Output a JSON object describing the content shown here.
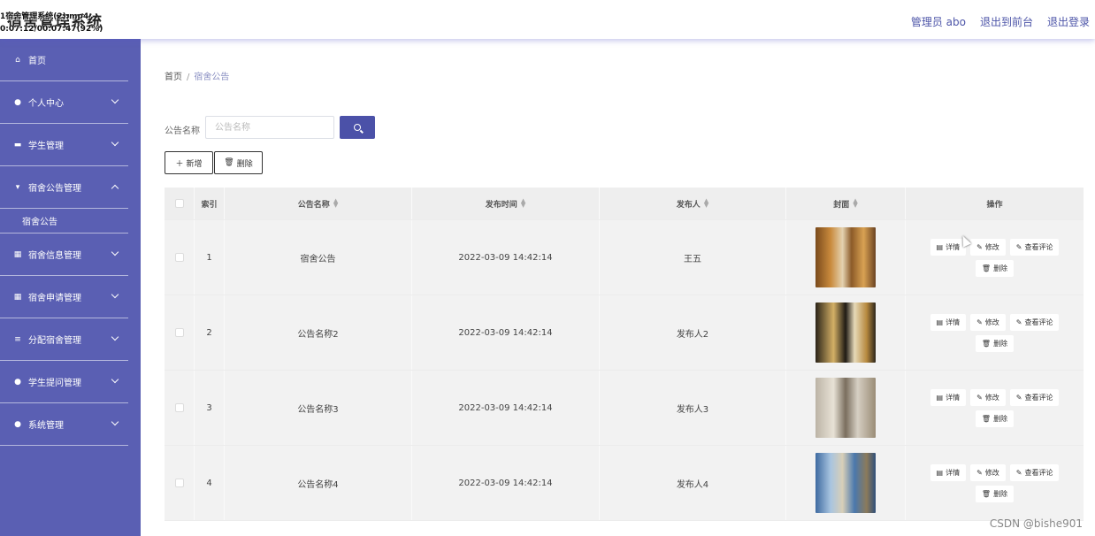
{
  "header": {
    "title": "宿舍管理系统",
    "overlay_lines": [
      "1宿舍管理系统(2).mp4",
      "0:07:12/00:07:47(92%)"
    ],
    "links": [
      "管理员 abo",
      "退出到前台",
      "退出登录"
    ]
  },
  "sidebar": {
    "items": [
      {
        "label": "首页",
        "icon": "home-icon",
        "glyph": "⌂",
        "chevron": false
      },
      {
        "label": "个人中心",
        "icon": "user-icon",
        "glyph": "●",
        "chevron": true
      },
      {
        "label": "学生管理",
        "icon": "chat-icon",
        "glyph": "▬",
        "chevron": true
      },
      {
        "label": "宿舍公告管理",
        "icon": "notice-icon",
        "glyph": "▾",
        "chevron": true
      },
      {
        "label": "宿舍信息管理",
        "icon": "grid-icon",
        "glyph": "▦",
        "chevron": true
      },
      {
        "label": "宿舍申请管理",
        "icon": "grid-icon",
        "glyph": "▦",
        "chevron": true
      },
      {
        "label": "分配宿舍管理",
        "icon": "list-icon",
        "glyph": "≡",
        "chevron": true
      },
      {
        "label": "学生提问管理",
        "icon": "pin-icon",
        "glyph": "●",
        "chevron": true
      },
      {
        "label": "系统管理",
        "icon": "user-icon",
        "glyph": "●",
        "chevron": true
      }
    ],
    "sub_item": "宿舍公告"
  },
  "breadcrumb": {
    "home": "首页",
    "sep": "/",
    "current": "宿舍公告"
  },
  "search": {
    "label": "公告名称",
    "placeholder": "公告名称"
  },
  "actions": {
    "add": "新增",
    "delete": "删除"
  },
  "table": {
    "headers": [
      "索引",
      "公告名称",
      "发布时间",
      "发布人",
      "封面",
      "操作"
    ],
    "rows": [
      {
        "index": "1",
        "name": "宿舍公告",
        "time": "2022-03-09 14:42:14",
        "publisher": "王五"
      },
      {
        "index": "2",
        "name": "公告名称2",
        "time": "2022-03-09 14:42:14",
        "publisher": "发布人2"
      },
      {
        "index": "3",
        "name": "公告名称3",
        "time": "2022-03-09 14:42:14",
        "publisher": "发布人3"
      },
      {
        "index": "4",
        "name": "公告名称4",
        "time": "2022-03-09 14:42:14",
        "publisher": "发布人4"
      }
    ],
    "ops": {
      "detail": "详情",
      "edit": "修改",
      "comments": "查看评论",
      "delete": "删除"
    }
  },
  "watermark": "CSDN @bishe901",
  "colors": {
    "sidebar": "#5a5fb3",
    "accent": "#4b51a8",
    "link": "#4d55a8"
  }
}
